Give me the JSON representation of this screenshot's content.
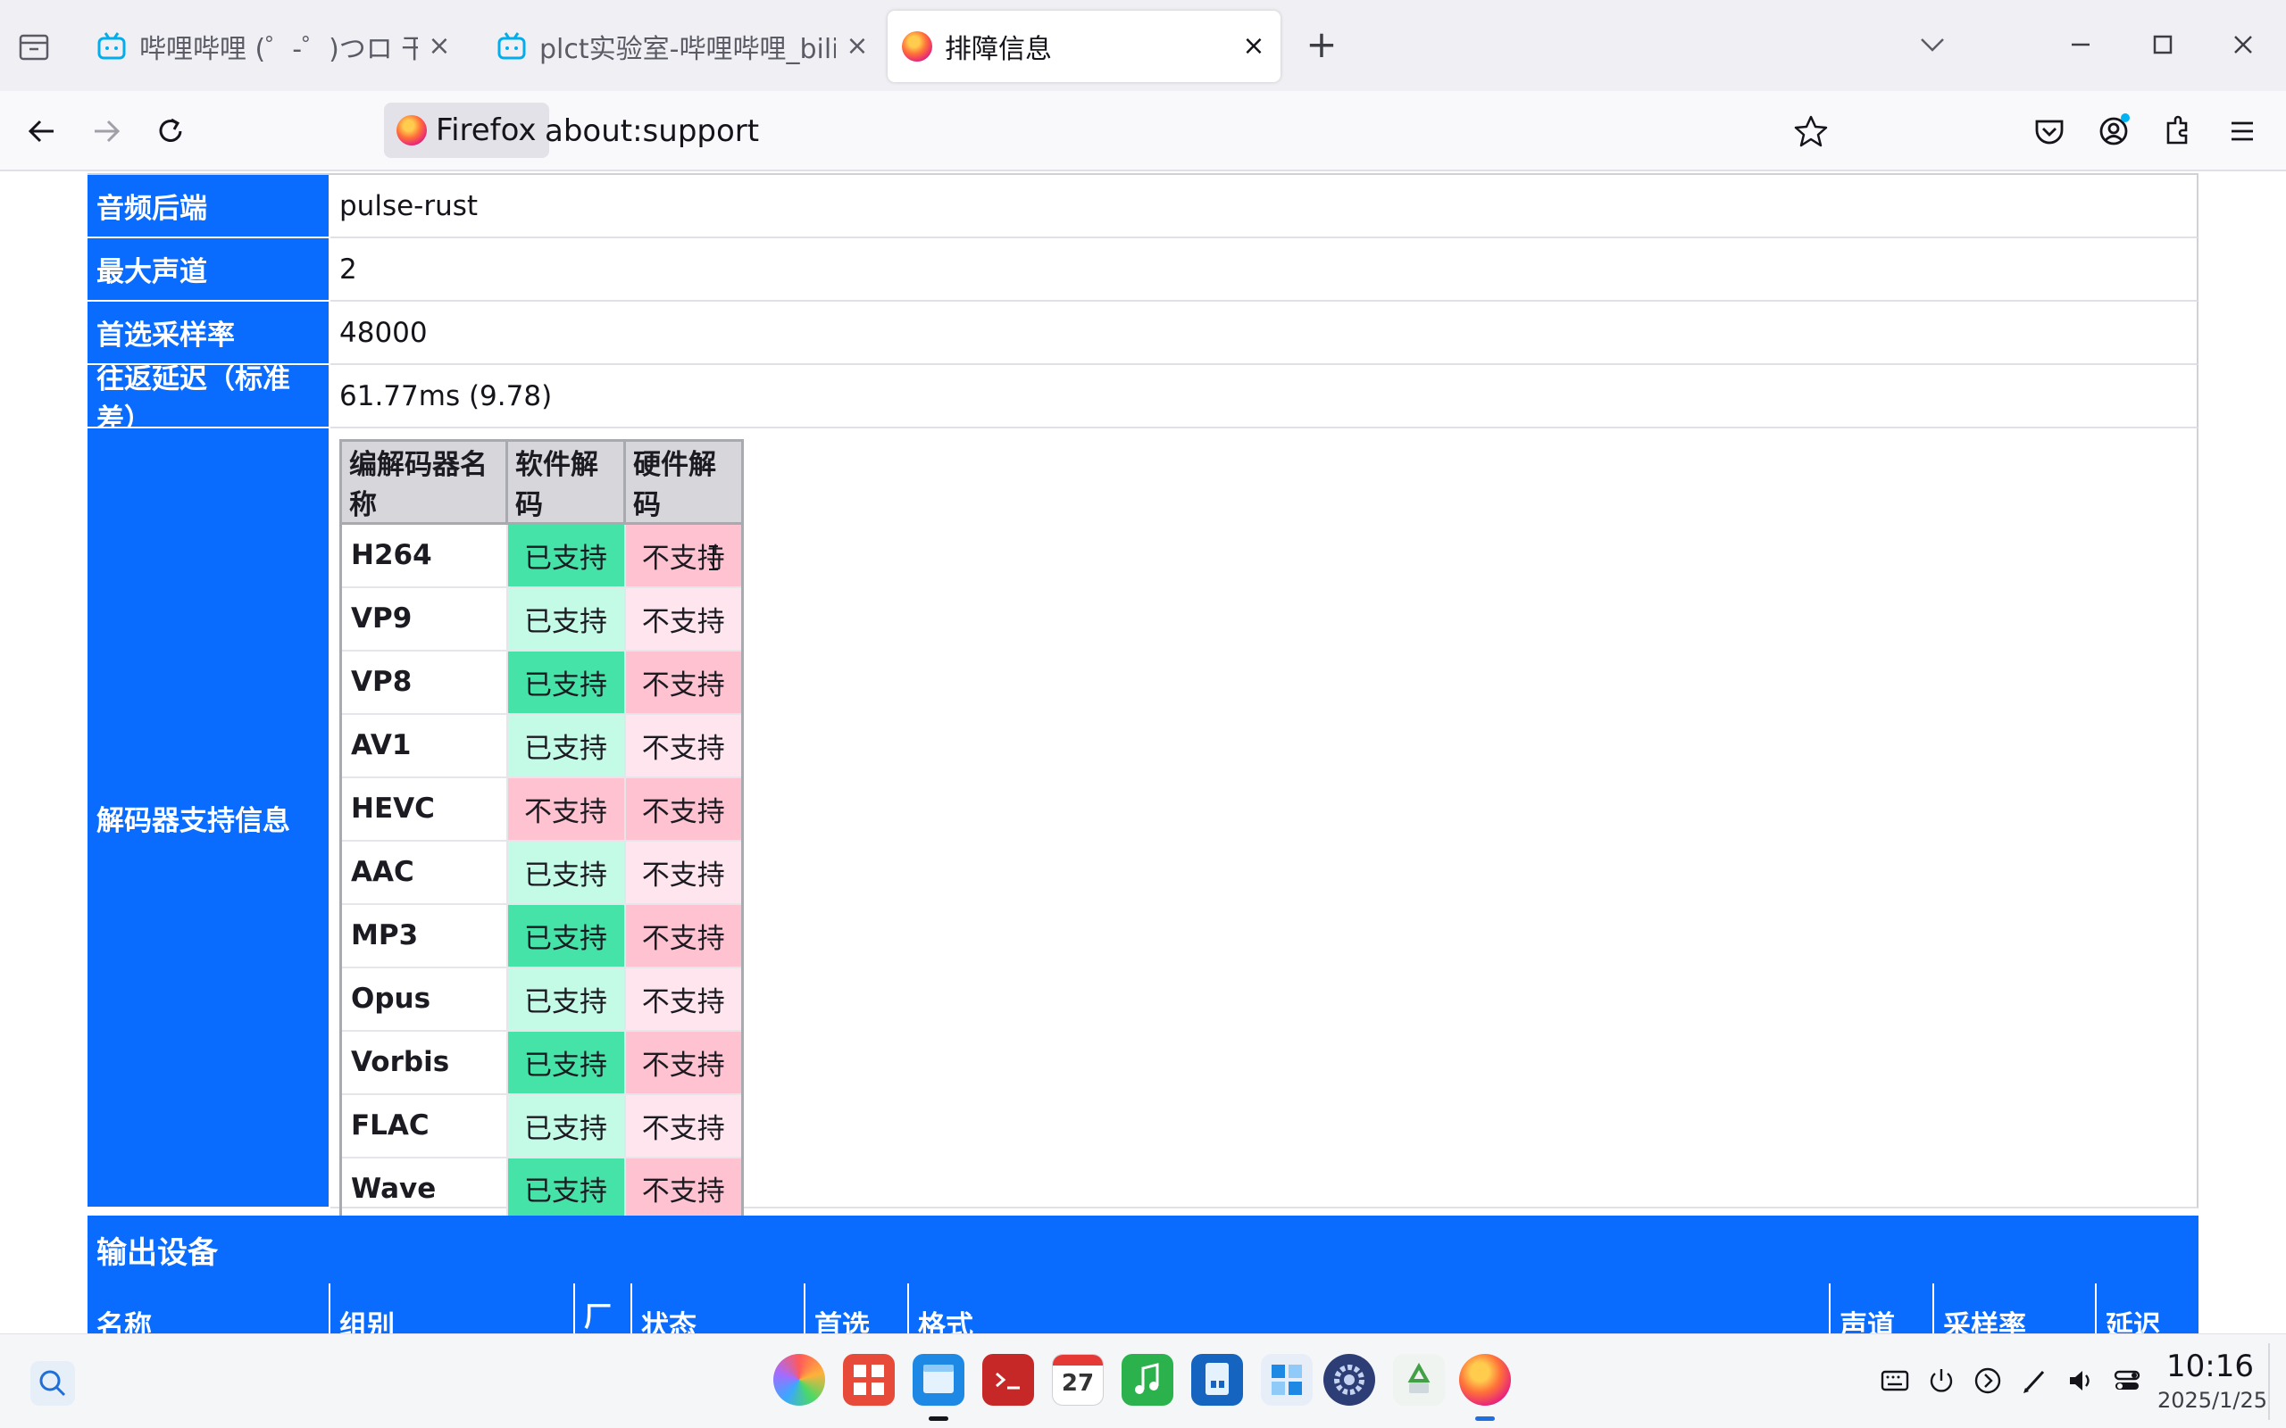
{
  "browser": {
    "tabs": [
      {
        "title": "哔哩哔哩 (゜-゜)つロ 干杯",
        "active": false,
        "favicon": "bilibili-icon"
      },
      {
        "title": "plct实验室-哔哩哔哩_bilib",
        "active": false,
        "favicon": "bilibili-icon"
      },
      {
        "title": "排障信息",
        "active": true,
        "favicon": "firefox-icon"
      }
    ],
    "identity_label": "Firefox",
    "url": "about:support"
  },
  "audio": {
    "rows": [
      {
        "label": "音频后端",
        "value": "pulse-rust"
      },
      {
        "label": "最大声道",
        "value": "2"
      },
      {
        "label": "首选采样率",
        "value": "48000"
      },
      {
        "label": "往返延迟（标准差）",
        "value": "61.77ms (9.78)"
      }
    ],
    "decoder_label": "解码器支持信息",
    "codec_headers": [
      "编解码器名称",
      "软件解码",
      "硬件解码"
    ],
    "codecs": [
      {
        "name": "H264",
        "software": "已支持",
        "hardware": "不支持",
        "shade": "strong"
      },
      {
        "name": "VP9",
        "software": "已支持",
        "hardware": "不支持",
        "shade": "light"
      },
      {
        "name": "VP8",
        "software": "已支持",
        "hardware": "不支持",
        "shade": "strong"
      },
      {
        "name": "AV1",
        "software": "已支持",
        "hardware": "不支持",
        "shade": "light"
      },
      {
        "name": "HEVC",
        "software": "不支持",
        "hardware": "不支持",
        "shade": "strong"
      },
      {
        "name": "AAC",
        "software": "已支持",
        "hardware": "不支持",
        "shade": "light"
      },
      {
        "name": "MP3",
        "software": "已支持",
        "hardware": "不支持",
        "shade": "strong"
      },
      {
        "name": "Opus",
        "software": "已支持",
        "hardware": "不支持",
        "shade": "light"
      },
      {
        "name": "Vorbis",
        "software": "已支持",
        "hardware": "不支持",
        "shade": "strong"
      },
      {
        "name": "FLAC",
        "software": "已支持",
        "hardware": "不支持",
        "shade": "light"
      },
      {
        "name": "Wave",
        "software": "已支持",
        "hardware": "不支持",
        "shade": "strong"
      }
    ],
    "output_section": "输出设备",
    "output_headers": [
      "名称",
      "组别",
      "厂",
      "状态",
      "首选",
      "格式",
      "声道",
      "采样率",
      "延迟"
    ]
  },
  "taskbar": {
    "apps": [
      "launcher-icon",
      "multitask-icon",
      "file-manager-icon",
      "terminal-icon",
      "calendar-icon",
      "music-icon",
      "document-viewer-icon",
      "calculator-icon",
      "settings-icon",
      "trash-icon",
      "firefox-icon"
    ],
    "calendar_day": "27",
    "time": "10:16",
    "date": "2025/1/25"
  },
  "colors": {
    "accent": "#0a6cff",
    "supported_strong": "#45e3a8",
    "supported_light": "#c4fbe6",
    "unsupported_strong": "#ffc2d1",
    "unsupported_light": "#ffe6ee"
  }
}
